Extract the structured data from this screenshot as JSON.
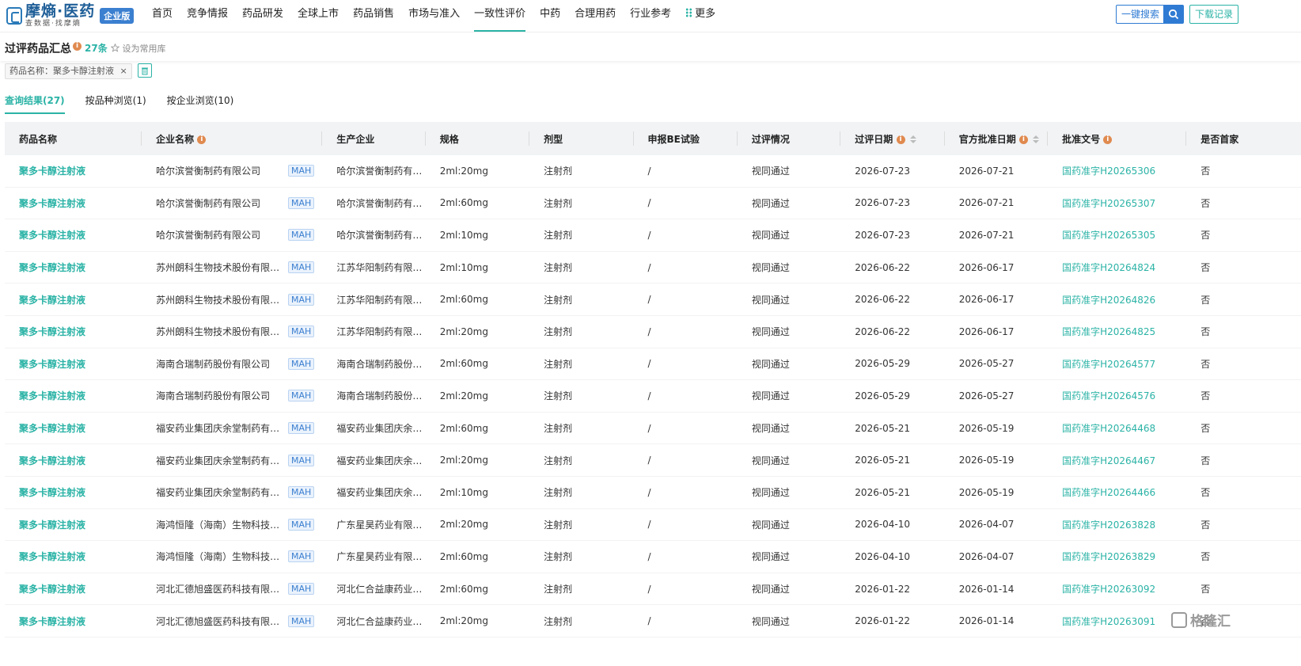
{
  "app": {
    "logo_main": "摩熵·医药",
    "logo_sub": "查数据·找摩熵",
    "edition": "企业版"
  },
  "nav": {
    "items": [
      "首页",
      "竞争情报",
      "药品研发",
      "全球上市",
      "药品销售",
      "市场与准入",
      "一致性评价",
      "中药",
      "合理用药",
      "行业参考"
    ],
    "active_index": 6,
    "more_label": "更多"
  },
  "header_actions": {
    "search_label": "一键搜索",
    "download_label": "下载记录"
  },
  "page": {
    "title": "过评药品汇总",
    "count": "27条",
    "fav_label": "设为常用库"
  },
  "filter": {
    "tag_label": "药品名称：聚多卡醇注射液",
    "tag_close": "×"
  },
  "tabs": [
    {
      "label": "查询结果(27)",
      "active": true
    },
    {
      "label": "按品种浏览(1)",
      "active": false
    },
    {
      "label": "按企业浏览(10)",
      "active": false
    }
  ],
  "table": {
    "columns": [
      "药品名称",
      "企业名称",
      "生产企业",
      "规格",
      "剂型",
      "申报BE试验",
      "过评情况",
      "过评日期",
      "官方批准日期",
      "批准文号",
      "是否首家"
    ],
    "mah_label": "MAH",
    "rows": [
      [
        "聚多卡醇注射液",
        "哈尔滨誉衡制药有限公司",
        "哈尔滨誉衡制药有…",
        "2ml:20mg",
        "注射剂",
        "/",
        "视同通过",
        "2026-07-23",
        "2026-07-21",
        "国药准字H20265306",
        "否"
      ],
      [
        "聚多卡醇注射液",
        "哈尔滨誉衡制药有限公司",
        "哈尔滨誉衡制药有…",
        "2ml:60mg",
        "注射剂",
        "/",
        "视同通过",
        "2026-07-23",
        "2026-07-21",
        "国药准字H20265307",
        "否"
      ],
      [
        "聚多卡醇注射液",
        "哈尔滨誉衡制药有限公司",
        "哈尔滨誉衡制药有…",
        "2ml:10mg",
        "注射剂",
        "/",
        "视同通过",
        "2026-07-23",
        "2026-07-21",
        "国药准字H20265305",
        "否"
      ],
      [
        "聚多卡醇注射液",
        "苏州朗科生物技术股份有限公司",
        "江苏华阳制药有限…",
        "2ml:10mg",
        "注射剂",
        "/",
        "视同通过",
        "2026-06-22",
        "2026-06-17",
        "国药准字H20264824",
        "否"
      ],
      [
        "聚多卡醇注射液",
        "苏州朗科生物技术股份有限公司",
        "江苏华阳制药有限…",
        "2ml:60mg",
        "注射剂",
        "/",
        "视同通过",
        "2026-06-22",
        "2026-06-17",
        "国药准字H20264826",
        "否"
      ],
      [
        "聚多卡醇注射液",
        "苏州朗科生物技术股份有限公司",
        "江苏华阳制药有限…",
        "2ml:20mg",
        "注射剂",
        "/",
        "视同通过",
        "2026-06-22",
        "2026-06-17",
        "国药准字H20264825",
        "否"
      ],
      [
        "聚多卡醇注射液",
        "海南合瑞制药股份有限公司",
        "海南合瑞制药股份…",
        "2ml:60mg",
        "注射剂",
        "/",
        "视同通过",
        "2026-05-29",
        "2026-05-27",
        "国药准字H20264577",
        "否"
      ],
      [
        "聚多卡醇注射液",
        "海南合瑞制药股份有限公司",
        "海南合瑞制药股份…",
        "2ml:20mg",
        "注射剂",
        "/",
        "视同通过",
        "2026-05-29",
        "2026-05-27",
        "国药准字H20264576",
        "否"
      ],
      [
        "聚多卡醇注射液",
        "福安药业集团庆余堂制药有限…",
        "福安药业集团庆余…",
        "2ml:60mg",
        "注射剂",
        "/",
        "视同通过",
        "2026-05-21",
        "2026-05-19",
        "国药准字H20264468",
        "否"
      ],
      [
        "聚多卡醇注射液",
        "福安药业集团庆余堂制药有限…",
        "福安药业集团庆余…",
        "2ml:20mg",
        "注射剂",
        "/",
        "视同通过",
        "2026-05-21",
        "2026-05-19",
        "国药准字H20264467",
        "否"
      ],
      [
        "聚多卡醇注射液",
        "福安药业集团庆余堂制药有限…",
        "福安药业集团庆余…",
        "2ml:10mg",
        "注射剂",
        "/",
        "视同通过",
        "2026-05-21",
        "2026-05-19",
        "国药准字H20264466",
        "否"
      ],
      [
        "聚多卡醇注射液",
        "海鸿恒隆（海南）生物科技有…",
        "广东星昊药业有限…",
        "2ml:20mg",
        "注射剂",
        "/",
        "视同通过",
        "2026-04-10",
        "2026-04-07",
        "国药准字H20263828",
        "否"
      ],
      [
        "聚多卡醇注射液",
        "海鸿恒隆（海南）生物科技有…",
        "广东星昊药业有限…",
        "2ml:60mg",
        "注射剂",
        "/",
        "视同通过",
        "2026-04-10",
        "2026-04-07",
        "国药准字H20263829",
        "否"
      ],
      [
        "聚多卡醇注射液",
        "河北汇德旭盛医药科技有限公司",
        "河北仁合益康药业…",
        "2ml:60mg",
        "注射剂",
        "/",
        "视同通过",
        "2026-01-22",
        "2026-01-14",
        "国药准字H20263092",
        "否"
      ],
      [
        "聚多卡醇注射液",
        "河北汇德旭盛医药科技有限公司",
        "河北仁合益康药业…",
        "2ml:20mg",
        "注射剂",
        "/",
        "视同通过",
        "2026-01-22",
        "2026-01-14",
        "国药准字H20263091",
        "否"
      ]
    ]
  },
  "watermark": "格隆汇",
  "colors": {
    "accent": "#2bb3a6",
    "brand": "#1f5f98",
    "button_blue": "#2f7bd3",
    "info": "#e08a4f"
  }
}
